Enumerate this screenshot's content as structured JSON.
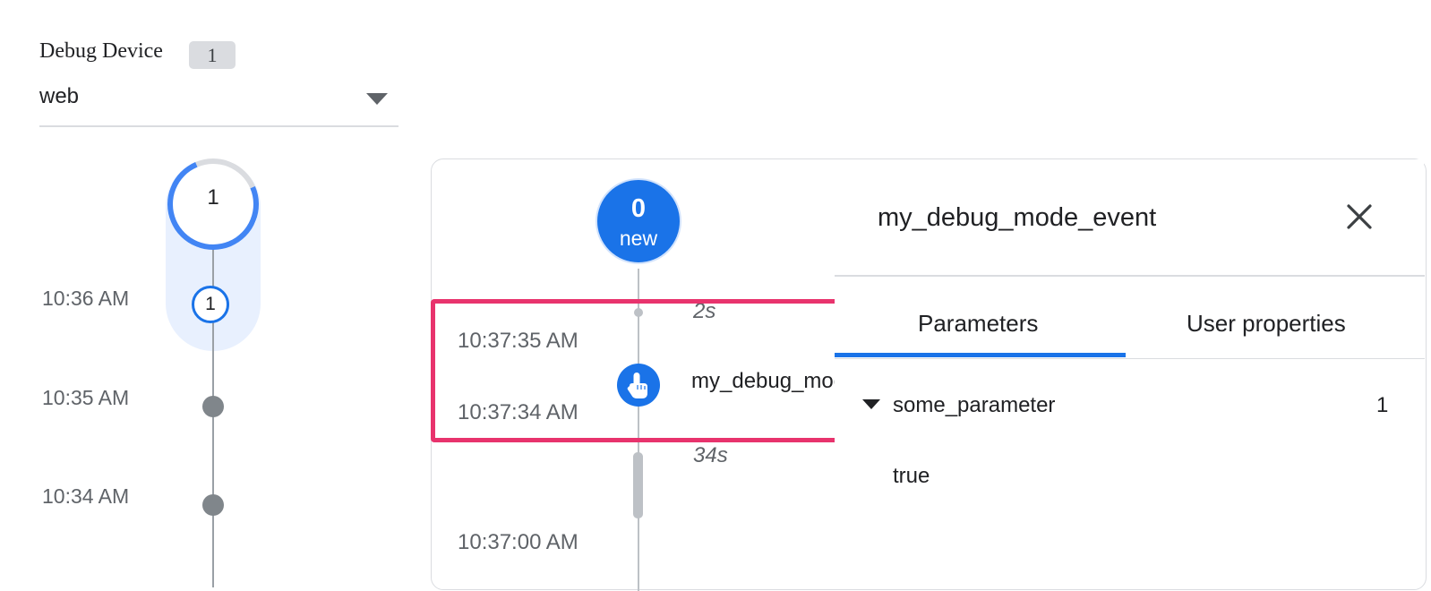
{
  "device": {
    "label": "Debug Device",
    "count": "1",
    "selected": "web"
  },
  "minutes_stream": {
    "total_count": "1",
    "rows": [
      {
        "time": "10:36 AM",
        "count": "1"
      },
      {
        "time": "10:35 AM"
      },
      {
        "time": "10:34 AM"
      }
    ]
  },
  "seconds_stream": {
    "new_count": "0",
    "new_label": "new",
    "deltas": [
      "2s",
      "34s"
    ],
    "times": [
      "10:37:35 AM",
      "10:37:34 AM",
      "10:37:00 AM"
    ],
    "events": [
      {
        "name": "my_debug_mode_event",
        "icon": "touch-icon"
      }
    ]
  },
  "detail": {
    "title": "my_debug_mode_event",
    "close_icon": "close-icon",
    "tabs": [
      "Parameters",
      "User properties"
    ],
    "active_tab": "Parameters",
    "parameters": [
      {
        "name": "some_parameter",
        "count": "1",
        "value": "true"
      }
    ]
  },
  "colors": {
    "accent": "#1a73e8",
    "highlight": "#e8336d",
    "pill": "#e8f0fe"
  }
}
